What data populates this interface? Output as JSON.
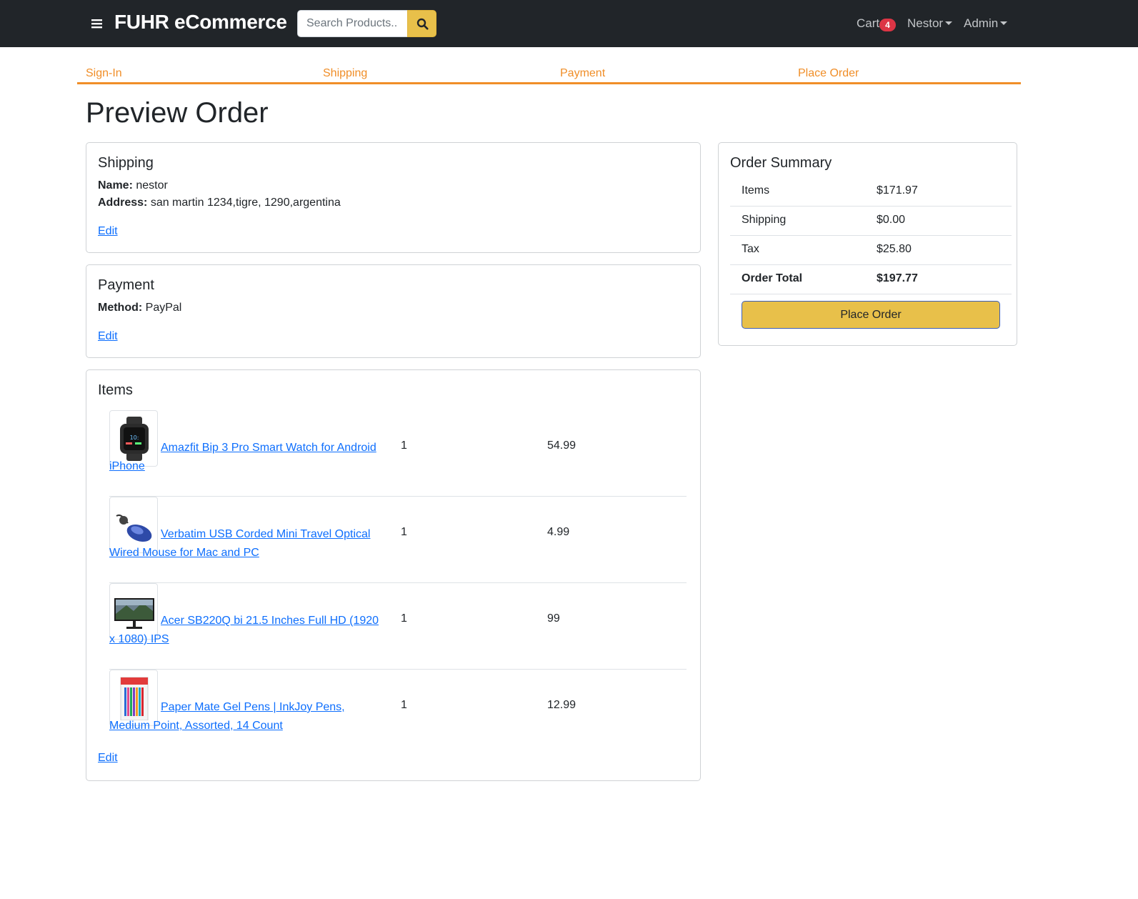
{
  "header": {
    "brand": "FUHR eCommerce",
    "search_placeholder": "Search Products..",
    "cart_label": "Cart",
    "cart_count": "4",
    "user_menu": "Nestor",
    "admin_menu": "Admin"
  },
  "checkout_steps": [
    "Sign-In",
    "Shipping",
    "Payment",
    "Place Order"
  ],
  "page_title": "Preview Order",
  "shipping": {
    "title": "Shipping",
    "name_label": "Name:",
    "name_value": "nestor",
    "address_label": "Address:",
    "address_value": "san martin 1234,tigre, 1290,argentina",
    "edit_label": "Edit"
  },
  "payment": {
    "title": "Payment",
    "method_label": "Method:",
    "method_value": "PayPal",
    "edit_label": "Edit"
  },
  "items": {
    "title": "Items",
    "list": [
      {
        "name_line1": "Amazfit Bip 3 Pro Smart Watch for Android",
        "name_line2": "iPhone",
        "quantity": "1",
        "price": "54.99",
        "image": "smartwatch-image"
      },
      {
        "name_line1": "Verbatim USB Corded Mini Travel Optical",
        "name_line2": "Wired Mouse for Mac and PC",
        "quantity": "1",
        "price": "4.99",
        "image": "mouse-image"
      },
      {
        "name_line1": "Acer SB220Q bi 21.5 Inches Full HD (1920",
        "name_line2": "x 1080) IPS",
        "quantity": "1",
        "price": "99",
        "image": "monitor-image"
      },
      {
        "name_line1": "Paper Mate Gel Pens | InkJoy Pens,",
        "name_line2": "Medium Point, Assorted, 14 Count",
        "quantity": "1",
        "price": "12.99",
        "image": "pens-image"
      }
    ],
    "edit_label": "Edit"
  },
  "order_summary": {
    "title": "Order Summary",
    "rows": [
      {
        "label": "Items",
        "value": "$171.97"
      },
      {
        "label": "Shipping",
        "value": "$0.00"
      },
      {
        "label": "Tax",
        "value": "$25.80"
      },
      {
        "label": "Order Total",
        "value": "$197.77"
      }
    ],
    "place_order_label": "Place Order"
  },
  "colors": {
    "navbar": "#212529",
    "accent_orange": "#f08e28",
    "button_yellow": "#e8c04a",
    "link_blue": "#0d6efd",
    "badge_red": "#dc3545"
  }
}
